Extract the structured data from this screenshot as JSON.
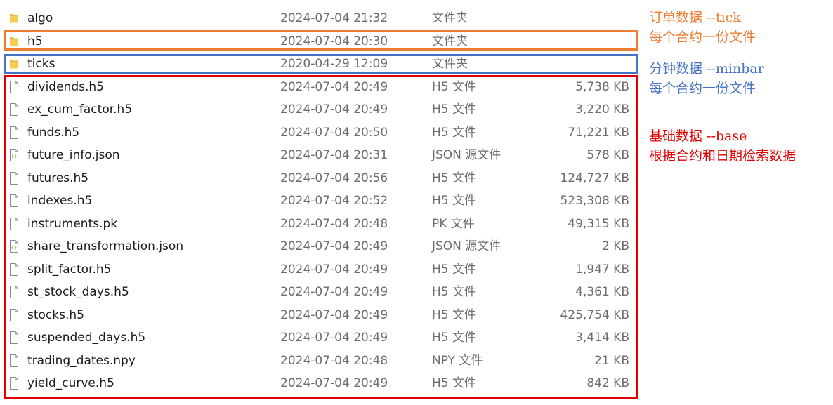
{
  "files": [
    {
      "name": "algo",
      "date": "2024-07-04 21:32",
      "type": "文件夹",
      "size": "",
      "icon": "folder-icon"
    },
    {
      "name": "h5",
      "date": "2024-07-04 20:30",
      "type": "文件夹",
      "size": "",
      "icon": "folder-icon"
    },
    {
      "name": "ticks",
      "date": "2020-04-29 12:09",
      "type": "文件夹",
      "size": "",
      "icon": "folder-icon"
    },
    {
      "name": "dividends.h5",
      "date": "2024-07-04 20:49",
      "type": "H5 文件",
      "size": "5,738 KB",
      "icon": "file-icon"
    },
    {
      "name": "ex_cum_factor.h5",
      "date": "2024-07-04 20:49",
      "type": "H5 文件",
      "size": "3,220 KB",
      "icon": "file-icon"
    },
    {
      "name": "funds.h5",
      "date": "2024-07-04 20:50",
      "type": "H5 文件",
      "size": "71,221 KB",
      "icon": "file-icon"
    },
    {
      "name": "future_info.json",
      "date": "2024-07-04 20:31",
      "type": "JSON 源文件",
      "size": "578 KB",
      "icon": "json-icon"
    },
    {
      "name": "futures.h5",
      "date": "2024-07-04 20:56",
      "type": "H5 文件",
      "size": "124,727 KB",
      "icon": "file-icon"
    },
    {
      "name": "indexes.h5",
      "date": "2024-07-04 20:52",
      "type": "H5 文件",
      "size": "523,308 KB",
      "icon": "file-icon"
    },
    {
      "name": "instruments.pk",
      "date": "2024-07-04 20:48",
      "type": "PK 文件",
      "size": "49,315 KB",
      "icon": "file-icon"
    },
    {
      "name": "share_transformation.json",
      "date": "2024-07-04 20:49",
      "type": "JSON 源文件",
      "size": "2 KB",
      "icon": "json-icon"
    },
    {
      "name": "split_factor.h5",
      "date": "2024-07-04 20:49",
      "type": "H5 文件",
      "size": "1,947 KB",
      "icon": "file-icon"
    },
    {
      "name": "st_stock_days.h5",
      "date": "2024-07-04 20:49",
      "type": "H5 文件",
      "size": "4,361 KB",
      "icon": "file-icon"
    },
    {
      "name": "stocks.h5",
      "date": "2024-07-04 20:49",
      "type": "H5 文件",
      "size": "425,754 KB",
      "icon": "file-icon"
    },
    {
      "name": "suspended_days.h5",
      "date": "2024-07-04 20:49",
      "type": "H5 文件",
      "size": "3,414 KB",
      "icon": "file-icon"
    },
    {
      "name": "trading_dates.npy",
      "date": "2024-07-04 20:48",
      "type": "NPY 文件",
      "size": "21 KB",
      "icon": "file-icon"
    },
    {
      "name": "yield_curve.h5",
      "date": "2024-07-04 20:49",
      "type": "H5 文件",
      "size": "842 KB",
      "icon": "file-icon"
    }
  ],
  "annotations": {
    "tick": {
      "line1": "订单数据 --tick",
      "line2": "每个合约一份文件",
      "color": "#ed7d31"
    },
    "minbar": {
      "line1": "分钟数据 --minbar",
      "line2": "每个合约一份文件",
      "color": "#4472c4"
    },
    "base": {
      "line1": "基础数据 --base",
      "line2": "根据合约和日期检索数据",
      "color": "#e00000"
    }
  }
}
